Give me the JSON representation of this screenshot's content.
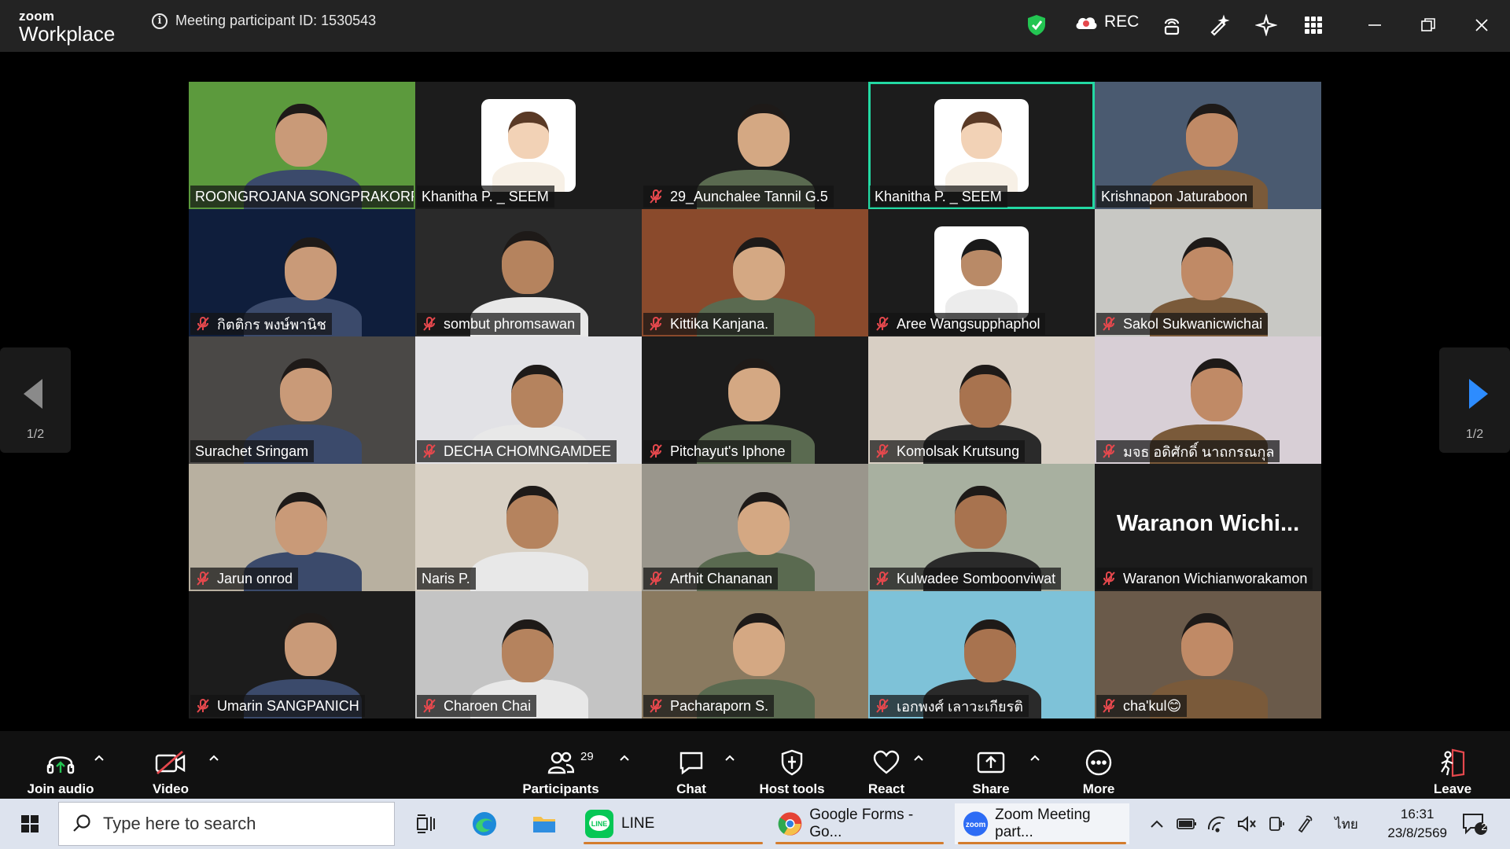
{
  "titlebar": {
    "logo_line1": "zoom",
    "logo_line2": "Workplace",
    "meeting_id": "Meeting participant ID: 1530543",
    "rec_label": "REC"
  },
  "participants": [
    {
      "name": "ROONGROJANA SONGPRAKORP",
      "muted": false,
      "bg": "#5c9a3d"
    },
    {
      "name": "Khanitha P. _ SEEM",
      "muted": false,
      "bg": "#1c1c1c"
    },
    {
      "name": "29_Aunchalee Tannil G.5",
      "muted": true,
      "bg": "#1c1c1c"
    },
    {
      "name": "Khanitha P. _ SEEM",
      "muted": false,
      "bg": "#1c1c1c",
      "speaking": true
    },
    {
      "name": "Krishnapon Jaturaboon",
      "muted": false,
      "bg": "#4a5a70"
    },
    {
      "name": "กิตติกร พงษ์พานิช",
      "muted": true,
      "bg": "#0f1e3c"
    },
    {
      "name": "sombut phromsawan",
      "muted": true,
      "bg": "#2a2a2a"
    },
    {
      "name": "Kittika Kanjana.",
      "muted": true,
      "bg": "#8a4a2c"
    },
    {
      "name": "Aree Wangsupphaphol",
      "muted": true,
      "bg": "#1c1c1c"
    },
    {
      "name": "Sakol Sukwanicwichai",
      "muted": true,
      "bg": "#c8c8c4"
    },
    {
      "name": "Surachet Sringam",
      "muted": false,
      "bg": "#4a4846"
    },
    {
      "name": "DECHA CHOMNGAMDEE",
      "muted": true,
      "bg": "#e2e2e6"
    },
    {
      "name": "Pitchayut's Iphone",
      "muted": true,
      "bg": "#1c1c1c"
    },
    {
      "name": "Komolsak Krutsung",
      "muted": true,
      "bg": "#d8cfc4"
    },
    {
      "name": "มจธ อดิศักดิ์ นาถกรณกุล",
      "muted": true,
      "bg": "#d8cfd6"
    },
    {
      "name": "Jarun onrod",
      "muted": true,
      "bg": "#b8b0a0"
    },
    {
      "name": "Naris P.",
      "muted": false,
      "bg": "#d8d0c4"
    },
    {
      "name": "Arthit Chananan",
      "muted": true,
      "bg": "#9a968c"
    },
    {
      "name": "Kulwadee Somboonviwat",
      "muted": true,
      "bg": "#a8b0a0"
    },
    {
      "name": "Waranon Wichianworakamon",
      "muted": true,
      "bg": "#1c1c1c",
      "display_text": "Waranon  Wichi..."
    },
    {
      "name": "Umarin SANGPANICH",
      "muted": true,
      "bg": "#1c1c1c"
    },
    {
      "name": "Charoen Chai",
      "muted": true,
      "bg": "#c4c4c4"
    },
    {
      "name": "Pacharaporn S.",
      "muted": true,
      "bg": "#8a7a60"
    },
    {
      "name": "เอกพงศ์ เลาวะเกียรติ",
      "muted": true,
      "bg": "#7ec2d8"
    },
    {
      "name": "cha'kul😊",
      "muted": true,
      "bg": "#6a5a4a"
    }
  ],
  "pager": {
    "left_page": "1/2",
    "right_page": "1/2"
  },
  "toolbar": {
    "join_audio": "Join audio",
    "video": "Video",
    "participants": "Participants",
    "participants_count": "29",
    "chat": "Chat",
    "host_tools": "Host tools",
    "react": "React",
    "share": "Share",
    "more": "More",
    "leave": "Leave"
  },
  "taskbar": {
    "search_placeholder": "Type here to search",
    "apps": [
      "LINE",
      "Google Forms - Go...",
      "Zoom Meeting part..."
    ],
    "time": "16:31",
    "date": "23/8/2569",
    "language": "ไทย",
    "notification_count": "2"
  },
  "colors": {
    "speaking_border": "#23d9a3",
    "mute_red": "#e5484d",
    "rec_red": "#e5484d",
    "pager_arrow_active": "#2d8cff"
  }
}
